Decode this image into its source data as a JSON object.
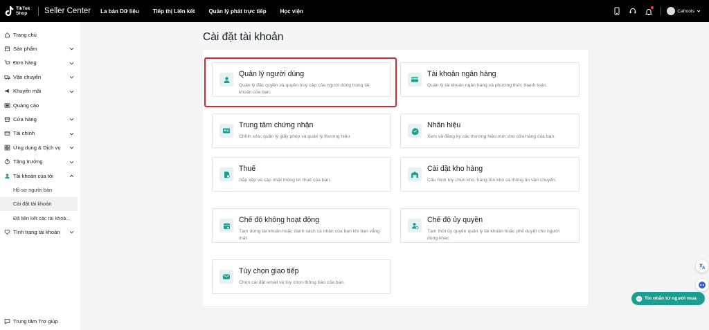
{
  "topbar": {
    "logo_text": "TikTok Shop",
    "app_name": "Seller Center",
    "nav": [
      "La bàn Dữ liệu",
      "Tiếp thị Liên kết",
      "Quản lý phát trực tiếp",
      "Học viện"
    ],
    "username": "Cafroots",
    "icons": [
      "phone-icon",
      "headset-icon",
      "bell-icon",
      "avatar",
      "chevron-down-icon"
    ]
  },
  "sidebar": {
    "items": [
      {
        "label": "Trang chủ",
        "icon": "home-icon",
        "arrow": false
      },
      {
        "label": "Sản phẩm",
        "icon": "product-icon",
        "arrow": true
      },
      {
        "label": "Đơn hàng",
        "icon": "order-icon",
        "arrow": true
      },
      {
        "label": "Vận chuyển",
        "icon": "truck-icon",
        "arrow": true
      },
      {
        "label": "Khuyến mãi",
        "icon": "megaphone-icon",
        "arrow": true
      },
      {
        "label": "Quảng cáo",
        "icon": "ad-icon",
        "arrow": false
      },
      {
        "label": "Cửa hàng",
        "icon": "store-icon",
        "arrow": true
      },
      {
        "label": "Tài chính",
        "icon": "finance-icon",
        "arrow": true
      },
      {
        "label": "Ứng dụng & Dịch vụ",
        "icon": "apps-icon",
        "arrow": true
      },
      {
        "label": "Tăng trưởng",
        "icon": "growth-icon",
        "arrow": true
      },
      {
        "label": "Tài khoản của tôi",
        "icon": "user-icon",
        "arrow": true,
        "expanded": true
      }
    ],
    "subitems": [
      "Hồ sơ người bán",
      "Cài đặt tài khoản",
      "Đã liên kết các tài khoả..."
    ],
    "active_subitem": "Cài đặt tài khoản",
    "last_item": {
      "label": "Tình trạng tài khoản",
      "icon": "health-icon",
      "arrow": true
    },
    "help": "Trung tâm Trợ giúp"
  },
  "main": {
    "title": "Cài đặt tài khoản",
    "accent_color": "#1a9e8f",
    "highlight_color": "#e5232d",
    "cards": [
      {
        "title": "Quản lý người dùng",
        "desc": "Quản lý đặc quyền và quyền truy cập của người dùng trong tài khoản của bạn.",
        "icon": "user-manage-icon"
      },
      {
        "title": "Tài khoản ngân hàng",
        "desc": "Quản lý tài khoản ngân hàng và phương thức thanh toán.",
        "icon": "bank-card-icon"
      },
      {
        "title": "Trung tâm chứng nhận",
        "desc": "Chỉnh sửa, quản lý giấy phép và quản lý thương hiệu",
        "icon": "id-card-icon"
      },
      {
        "title": "Nhãn hiệu",
        "desc": "Xem và đăng ký các thương hiệu mới cho cửa hàng của bạn.",
        "icon": "badge-icon"
      },
      {
        "title": "Thuế",
        "desc": "Sắp xếp và cập nhật thông tin thuế của bạn.",
        "icon": "tax-icon"
      },
      {
        "title": "Cài đặt kho hàng",
        "desc": "Cấu hình tùy chọn kho, hàng tồn kho và thông tin vận chuyển.",
        "icon": "warehouse-icon"
      },
      {
        "title": "Chế độ không hoạt động",
        "desc": "Tạm dừng tài khoản hoặc danh sách cá nhân của bạn khi bạn vắng mặt.",
        "icon": "calendar-icon"
      },
      {
        "title": "Chế độ ủy quyền",
        "desc": "Tạm thời ủy quyền quản lý tài khoản hoặc phê duyệt cho người dùng khác.",
        "icon": "delegate-icon"
      },
      {
        "title": "Tùy chọn giao tiếp",
        "desc": "Chọn cài đặt email và tùy chọn thông báo của bạn.",
        "icon": "mail-icon"
      }
    ]
  },
  "floating": {
    "chat_button": "Tin nhắn từ người mua",
    "icons": [
      "translate-icon",
      "assistant-icon"
    ]
  }
}
